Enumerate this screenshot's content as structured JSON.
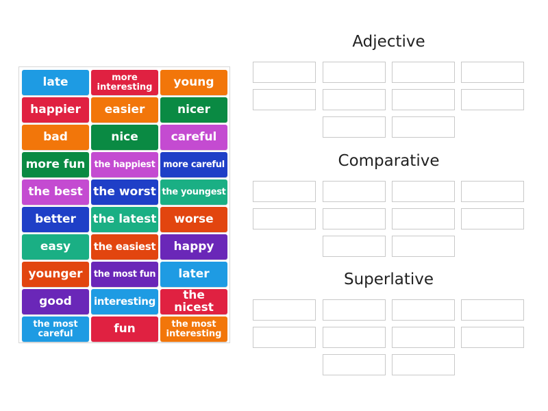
{
  "colors": {
    "blue": "#1e9be3",
    "red": "#e02141",
    "orange": "#f2760a",
    "green": "#0a8a43",
    "purple": "#c44bd1",
    "navy": "#1f3fc7",
    "teal": "#1aaf84",
    "vermilion": "#e2450f",
    "violet": "#6a27b8"
  },
  "tiles": [
    {
      "text": "late",
      "color": "blue",
      "size": "l"
    },
    {
      "text": "more interesting",
      "color": "red",
      "size": "xs"
    },
    {
      "text": "young",
      "color": "orange",
      "size": "l"
    },
    {
      "text": "happier",
      "color": "red",
      "size": "l"
    },
    {
      "text": "easier",
      "color": "orange",
      "size": "l"
    },
    {
      "text": "nicer",
      "color": "green",
      "size": "l"
    },
    {
      "text": "bad",
      "color": "orange",
      "size": "l"
    },
    {
      "text": "nice",
      "color": "green",
      "size": "l"
    },
    {
      "text": "careful",
      "color": "purple",
      "size": "l"
    },
    {
      "text": "more fun",
      "color": "green",
      "size": "l"
    },
    {
      "text": "the happiest",
      "color": "purple",
      "size": "s"
    },
    {
      "text": "more careful",
      "color": "navy",
      "size": "s"
    },
    {
      "text": "the best",
      "color": "purple",
      "size": "l"
    },
    {
      "text": "the worst",
      "color": "navy",
      "size": "l"
    },
    {
      "text": "the youngest",
      "color": "teal",
      "size": "s"
    },
    {
      "text": "better",
      "color": "navy",
      "size": "l"
    },
    {
      "text": "the latest",
      "color": "teal",
      "size": "l"
    },
    {
      "text": "worse",
      "color": "vermilion",
      "size": "l"
    },
    {
      "text": "easy",
      "color": "teal",
      "size": "l"
    },
    {
      "text": "the easiest",
      "color": "vermilion",
      "size": "m"
    },
    {
      "text": "happy",
      "color": "violet",
      "size": "l"
    },
    {
      "text": "younger",
      "color": "vermilion",
      "size": "l"
    },
    {
      "text": "the most fun",
      "color": "violet",
      "size": "s"
    },
    {
      "text": "later",
      "color": "blue",
      "size": "l"
    },
    {
      "text": "good",
      "color": "violet",
      "size": "l"
    },
    {
      "text": "interesting",
      "color": "blue",
      "size": "m"
    },
    {
      "text": "the nicest",
      "color": "red",
      "size": "l"
    },
    {
      "text": "the most careful",
      "color": "blue",
      "size": "xs"
    },
    {
      "text": "fun",
      "color": "red",
      "size": "l"
    },
    {
      "text": "the most interesting",
      "color": "orange",
      "size": "xs"
    }
  ],
  "groups": [
    {
      "title": "Adjective",
      "slots": 10
    },
    {
      "title": "Comparative",
      "slots": 10
    },
    {
      "title": "Superlative",
      "slots": 10
    }
  ]
}
